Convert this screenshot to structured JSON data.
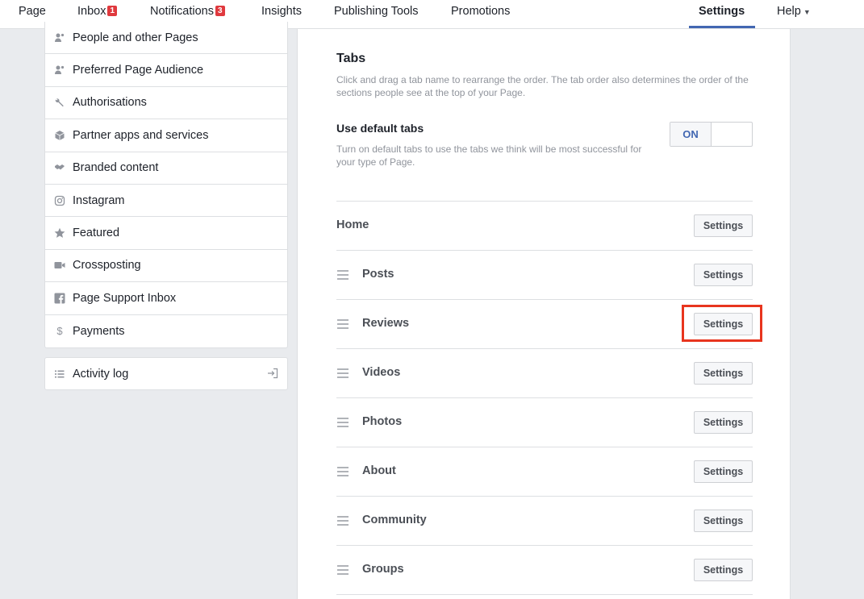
{
  "topnav": {
    "items": [
      {
        "label": "Page"
      },
      {
        "label": "Inbox",
        "badge": "1"
      },
      {
        "label": "Notifications",
        "badge": "3"
      },
      {
        "label": "Insights"
      },
      {
        "label": "Publishing Tools"
      },
      {
        "label": "Promotions"
      },
      {
        "label": "Settings",
        "active": true
      },
      {
        "label": "Help"
      }
    ]
  },
  "sidebar": {
    "items": [
      {
        "label": "People and other Pages",
        "icon": "people-icon"
      },
      {
        "label": "Preferred Page Audience",
        "icon": "people-icon"
      },
      {
        "label": "Authorisations",
        "icon": "wrench-icon"
      },
      {
        "label": "Partner apps and services",
        "icon": "cube-icon"
      },
      {
        "label": "Branded content",
        "icon": "handshake-icon"
      },
      {
        "label": "Instagram",
        "icon": "instagram-icon"
      },
      {
        "label": "Featured",
        "icon": "star-icon"
      },
      {
        "label": "Crossposting",
        "icon": "video-icon"
      },
      {
        "label": "Page Support Inbox",
        "icon": "facebook-icon"
      },
      {
        "label": "Payments",
        "icon": "dollar-icon"
      }
    ],
    "activity_log": {
      "label": "Activity log",
      "icon": "list-icon"
    }
  },
  "main": {
    "title": "Tabs",
    "description": "Click and drag a tab name to rearrange the order. The tab order also determines the order of the sections people see at the top of your Page.",
    "default_tabs": {
      "title": "Use default tabs",
      "description": "Turn on default tabs to use the tabs we think will be most successful for your type of Page.",
      "toggle_label": "ON"
    },
    "settings_label": "Settings",
    "tabs": [
      {
        "label": "Home"
      },
      {
        "label": "Posts"
      },
      {
        "label": "Reviews"
      },
      {
        "label": "Videos"
      },
      {
        "label": "Photos"
      },
      {
        "label": "About"
      },
      {
        "label": "Community"
      },
      {
        "label": "Groups"
      }
    ]
  },
  "colors": {
    "accent": "#4267b2",
    "badge": "#e0393e",
    "highlight": "#e8351e",
    "background": "#e9ebee"
  }
}
